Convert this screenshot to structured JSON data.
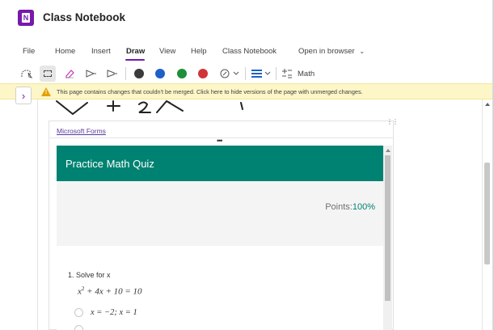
{
  "app": {
    "title": "Class Notebook",
    "logo_letter": "N"
  },
  "menu": {
    "items": [
      "File",
      "Home",
      "Insert",
      "Draw",
      "View",
      "Help",
      "Class Notebook"
    ],
    "active": "Draw",
    "open_in_browser": "Open in browser"
  },
  "toolbar": {
    "math_label": "Math",
    "pen_colors": [
      "#3b3b3b",
      "#1f5fc9",
      "#1f8f3a",
      "#d13438"
    ],
    "icons": [
      "lasso-select-icon",
      "marquee-select-icon",
      "eraser-icon",
      "pen-tool-icon",
      "highlighter-tool-icon",
      "pen-black-icon",
      "pen-blue-icon",
      "pen-green-icon",
      "pen-red-icon",
      "add-pen-icon",
      "line-thickness-icon",
      "math-icon"
    ]
  },
  "warning": {
    "text": "This page contains changes that couldn't be merged. Click here to hide versions of the page with unmerged changes."
  },
  "embed": {
    "link_text": "Microsoft Forms"
  },
  "quiz": {
    "title": "Practice Math Quiz",
    "points_label": "Points:",
    "points_value": "100%",
    "question": {
      "label": "1. Solve for x",
      "equation_prefix": "x",
      "equation_exponent": "2",
      "equation_rest": " + 4x + 10 = 10",
      "options": [
        "x = −2; x = 1"
      ]
    }
  },
  "colors": {
    "accent": "#7719aa",
    "forms_header": "#008272",
    "warning_bg": "#fdf6c7"
  }
}
